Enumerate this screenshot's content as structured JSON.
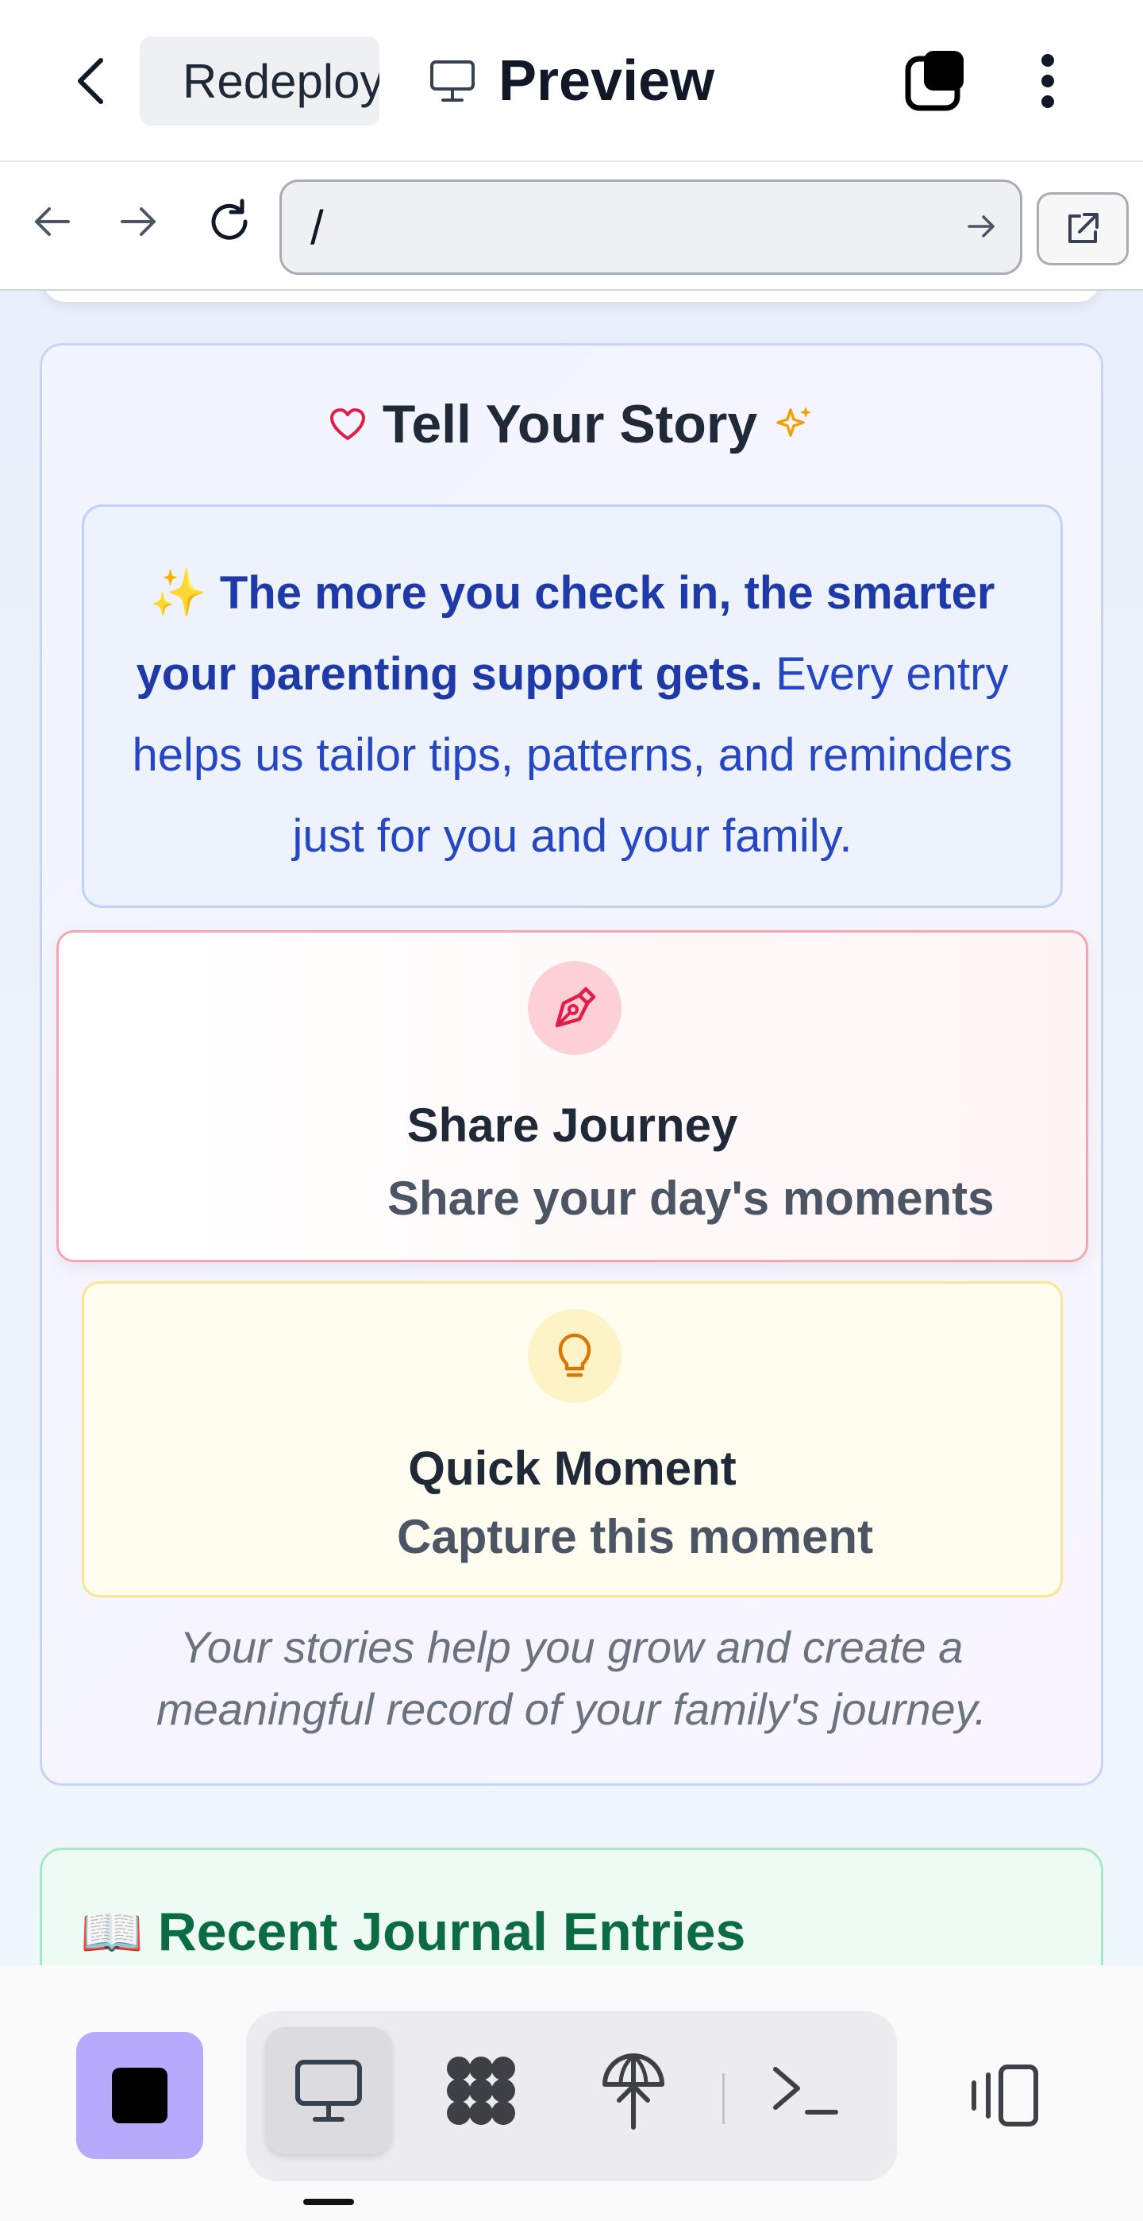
{
  "header": {
    "repl_tab_label": "Redeploy",
    "preview_label": "Preview"
  },
  "address_bar": {
    "url": "/"
  },
  "story": {
    "title": "Tell Your Story",
    "info_bold": "The more you check in, the smarter your parenting support gets.",
    "info_rest": "Every entry helps us tailor tips, patterns, and reminders just for you and your family.",
    "info_emoji": "✨",
    "share_title": "Share Journey",
    "share_sub": "Share your day's moments",
    "quick_title": "Quick Moment",
    "quick_sub": "Capture this moment",
    "footer": "Your stories help you grow and create a meaningful record of your family's journey."
  },
  "journal": {
    "title": "Recent Journal Entries",
    "emoji": "📖"
  },
  "colors": {
    "accent_purple": "#b7a9fb",
    "heart_red": "#e11d48",
    "sparkle_amber": "#f59e0b",
    "info_blue": "#2647c4",
    "journal_green": "#0b6b43"
  },
  "icons": {
    "back": "chevron-left-icon",
    "repl": "replit-tree-icon",
    "preview": "monitor-icon",
    "tabs": "tabs-square-icon",
    "menu": "kebab-menu-icon",
    "nav_back": "arrow-left-icon",
    "nav_forward": "arrow-right-icon",
    "reload": "reload-icon",
    "go": "arrow-right-icon",
    "external": "external-link-icon",
    "heart": "heart-icon",
    "sparkles": "sparkles-icon",
    "pen": "pen-tool-icon",
    "lightbulb": "lightbulb-icon",
    "stop": "stop-icon",
    "preview_tool": "monitor-icon",
    "workflows": "workflow-icon",
    "deploy": "deploy-icon",
    "shell": "terminal-icon",
    "devices": "devices-icon"
  }
}
